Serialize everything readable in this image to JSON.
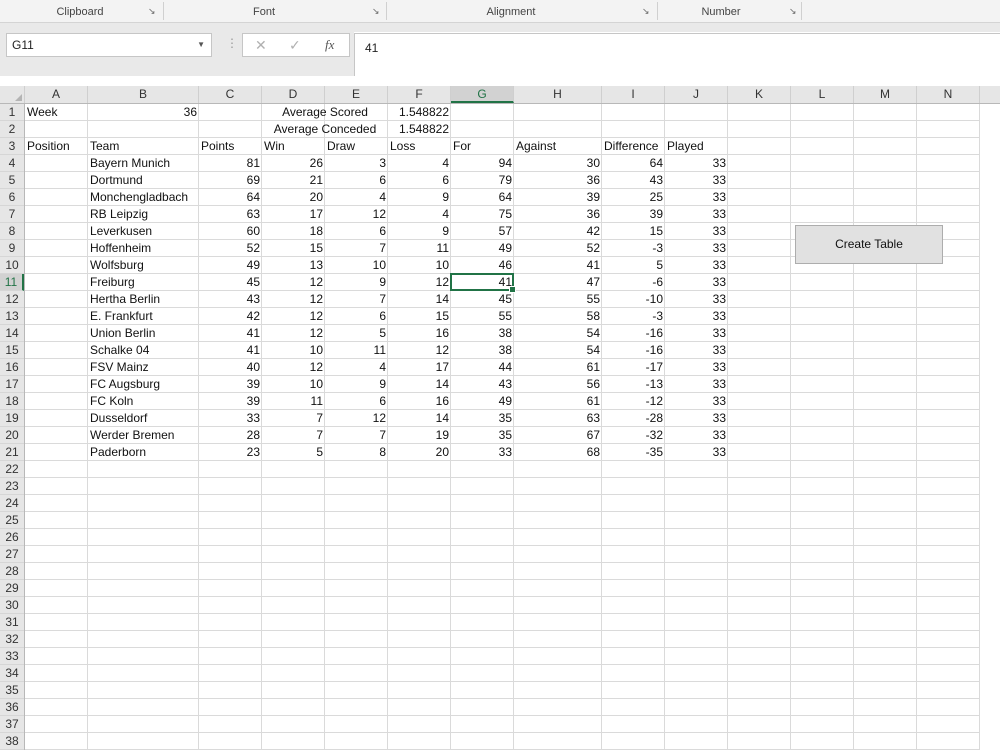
{
  "ribbon": {
    "groups": [
      {
        "label": "Clipboard"
      },
      {
        "label": "Font"
      },
      {
        "label": "Alignment"
      },
      {
        "label": "Number"
      }
    ],
    "launcher_icon": "dialog-launcher-icon"
  },
  "formula_bar": {
    "name_box": "G11",
    "formula": "41",
    "fx_label": "fx"
  },
  "sheet": {
    "columns": [
      "A",
      "B",
      "C",
      "D",
      "E",
      "F",
      "G",
      "H",
      "I",
      "J",
      "K",
      "L",
      "M",
      "N"
    ],
    "selected_column": "G",
    "selected_row": 11,
    "rows_visible": 39
  },
  "cells": {
    "A1": "Week",
    "B1": "36",
    "D1": "Average Scored",
    "F1": "1.548822",
    "D2": "Average Conceded",
    "F2": "1.548822",
    "A3": "Position",
    "B3": "Team",
    "C3": "Points",
    "D3": "Win",
    "E3": "Draw",
    "F3": "Loss",
    "G3": "For",
    "H3": "Against",
    "I3": "Difference",
    "J3": "Played"
  },
  "table": {
    "rows": [
      [
        "Bayern Munich",
        81,
        26,
        3,
        4,
        94,
        30,
        64,
        33
      ],
      [
        "Dortmund",
        69,
        21,
        6,
        6,
        79,
        36,
        43,
        33
      ],
      [
        "Monchengladbach",
        64,
        20,
        4,
        9,
        64,
        39,
        25,
        33
      ],
      [
        "RB Leipzig",
        63,
        17,
        12,
        4,
        75,
        36,
        39,
        33
      ],
      [
        "Leverkusen",
        60,
        18,
        6,
        9,
        57,
        42,
        15,
        33
      ],
      [
        "Hoffenheim",
        52,
        15,
        7,
        11,
        49,
        52,
        -3,
        33
      ],
      [
        "Wolfsburg",
        49,
        13,
        10,
        10,
        46,
        41,
        5,
        33
      ],
      [
        "Freiburg",
        45,
        12,
        9,
        12,
        41,
        47,
        -6,
        33
      ],
      [
        "Hertha Berlin",
        43,
        12,
        7,
        14,
        45,
        55,
        -10,
        33
      ],
      [
        "E. Frankfurt",
        42,
        12,
        6,
        15,
        55,
        58,
        -3,
        33
      ],
      [
        "Union Berlin",
        41,
        12,
        5,
        16,
        38,
        54,
        -16,
        33
      ],
      [
        "Schalke 04",
        41,
        10,
        11,
        12,
        38,
        54,
        -16,
        33
      ],
      [
        "FSV Mainz",
        40,
        12,
        4,
        17,
        44,
        61,
        -17,
        33
      ],
      [
        "FC Augsburg",
        39,
        10,
        9,
        14,
        43,
        56,
        -13,
        33
      ],
      [
        "FC Koln",
        39,
        11,
        6,
        16,
        49,
        61,
        -12,
        33
      ],
      [
        "Dusseldorf",
        33,
        7,
        12,
        14,
        35,
        63,
        -28,
        33
      ],
      [
        "Werder Bremen",
        28,
        7,
        7,
        19,
        35,
        67,
        -32,
        33
      ],
      [
        "Paderborn",
        23,
        5,
        8,
        20,
        33,
        68,
        -35,
        33
      ]
    ]
  },
  "button": {
    "label": "Create Table"
  },
  "colors": {
    "accent": "#217346"
  }
}
